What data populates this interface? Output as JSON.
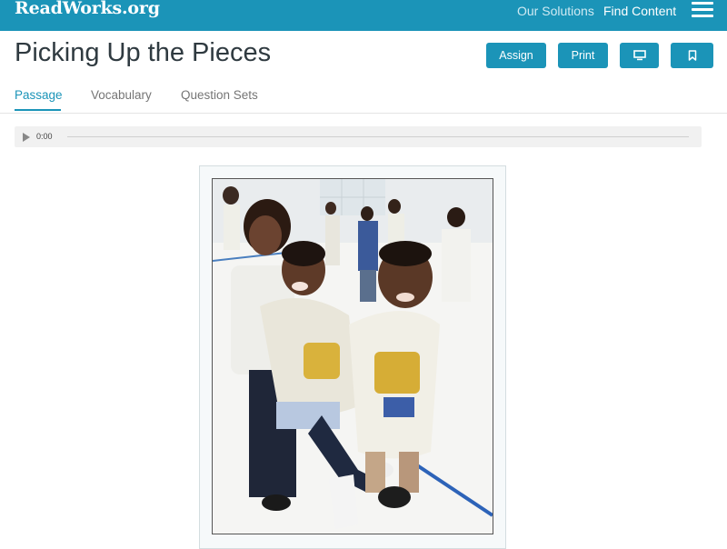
{
  "header": {
    "logo_text": "ReadWorks.org",
    "nav": {
      "solutions": "Our Solutions",
      "find_content": "Find Content"
    },
    "menu_icon": "hamburger-menu-icon",
    "brand_color": "#1b94b8"
  },
  "page": {
    "title": "Picking Up the Pieces",
    "buttons": {
      "assign": "Assign",
      "print": "Print",
      "present_icon": "monitor-icon",
      "bookmark_icon": "bookmark-icon"
    }
  },
  "tabs": {
    "passage": "Passage",
    "vocabulary": "Vocabulary",
    "question_sets": "Question Sets",
    "active": "Passage"
  },
  "audio": {
    "time": "0:00",
    "progress": 0
  },
  "passage_image": {
    "icon": "photo-image"
  }
}
